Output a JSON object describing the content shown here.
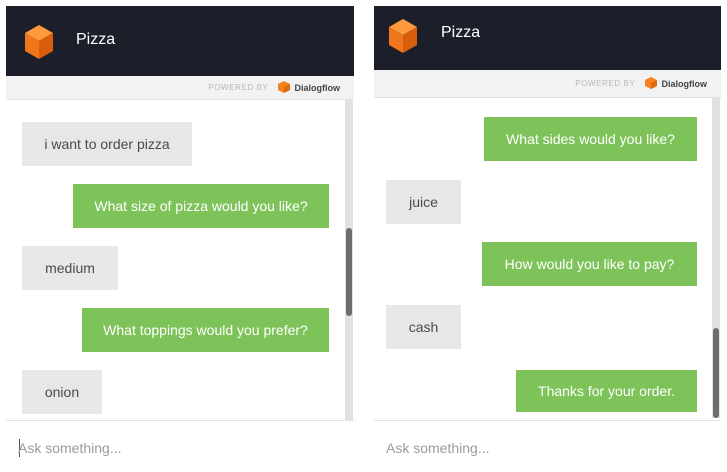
{
  "left": {
    "header": {
      "title": "Pizza"
    },
    "powered_by": {
      "label": "POWERED BY",
      "brand": "Dialogflow"
    },
    "messages": [
      {
        "role": "user",
        "text": "i want to order pizza"
      },
      {
        "role": "bot",
        "text": "What size of pizza would you like?"
      },
      {
        "role": "user",
        "text": "medium"
      },
      {
        "role": "bot",
        "text": "What toppings would you prefer?"
      },
      {
        "role": "user",
        "text": "onion"
      }
    ],
    "input": {
      "placeholder": "Ask something..."
    }
  },
  "right": {
    "header": {
      "title": "Pizza"
    },
    "powered_by": {
      "label": "POWERED BY",
      "brand": "Dialogflow"
    },
    "messages": [
      {
        "role": "bot",
        "text": "What sides would you like?"
      },
      {
        "role": "user",
        "text": "juice"
      },
      {
        "role": "bot",
        "text": "How would you like to pay?"
      },
      {
        "role": "user",
        "text": "cash"
      },
      {
        "role": "bot",
        "text": "Thanks for your order."
      }
    ],
    "input": {
      "placeholder": "Ask something..."
    }
  },
  "colors": {
    "header_bg": "#1c1f2a",
    "bot_bubble": "#7ec35a",
    "user_bubble": "#e7e7e7",
    "logo_orange": "#f58220"
  },
  "icons": {
    "agent_logo": "orange-cube-icon",
    "brand_logo": "dialogflow-icon"
  }
}
